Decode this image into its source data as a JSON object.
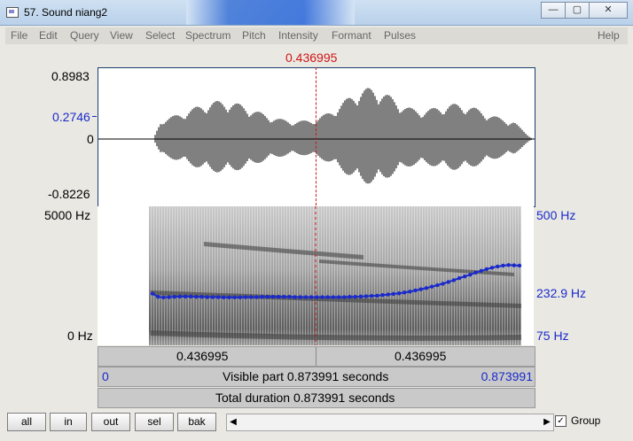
{
  "window": {
    "title": "57. Sound niang2",
    "minimize": "—",
    "maximize": "▢",
    "close": "✕"
  },
  "menu": [
    "File",
    "Edit",
    "Query",
    "View",
    "Select",
    "Spectrum",
    "Pitch",
    "Intensity",
    "Formant",
    "Pulses",
    "Help"
  ],
  "waveform": {
    "cursor_time": "0.436995",
    "y_max": "0.8983",
    "y_selected": "0.2746",
    "y_zero": "0",
    "y_min": "-0.8226"
  },
  "spectrogram": {
    "f_max": "5000 Hz",
    "f_min": "0 Hz",
    "pitch_max": "500 Hz",
    "pitch_cursor": "232.9 Hz",
    "pitch_min": "75 Hz",
    "pitch_contour_hz": [
      225,
      214,
      212,
      213,
      214,
      215,
      215,
      215,
      214,
      214,
      213,
      213,
      213,
      212,
      212,
      212,
      212,
      213,
      213,
      213,
      214,
      214,
      214,
      214,
      214,
      214,
      213,
      213,
      213,
      213,
      213,
      213,
      213,
      213,
      213,
      213,
      214,
      214,
      215,
      216,
      217,
      218,
      220,
      222,
      224,
      226,
      229,
      232,
      236,
      240,
      244,
      249,
      254,
      259,
      265,
      271,
      278,
      284,
      290,
      297,
      303,
      309,
      314,
      318,
      321,
      323,
      322,
      321
    ]
  },
  "bars": {
    "left_time": "0.436995",
    "right_time": "0.436995",
    "visible_start": "0",
    "visible_label": "Visible part 0.873991 seconds",
    "visible_end": "0.873991",
    "total_label": "Total duration 0.873991 seconds"
  },
  "buttons": {
    "all": "all",
    "in": "in",
    "out": "out",
    "sel": "sel",
    "bak": "bak"
  },
  "group": {
    "label": "Group",
    "checked": true,
    "mark": "✓"
  },
  "colors": {
    "accent_blue": "#1a2acb",
    "cursor_red": "#d21414"
  }
}
